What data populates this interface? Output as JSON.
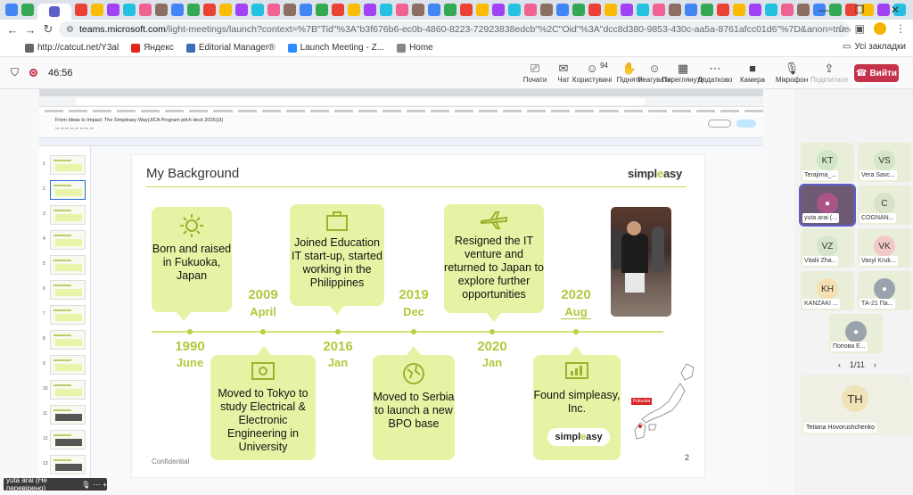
{
  "browser": {
    "url_domain": "teams.microsoft.com",
    "url_rest": "/light-meetings/launch?context=%7B\"Tid\"%3A\"b3f676b6-ec0b-4860-8223-72923838edcb\"%2C\"Oid\"%3A\"dcc8d380-9853-430c-aa5a-8761afcc01d6\"%7D&anon=true&lightExperience=true&correlationId=bbdd7927-5f89-4708-9f55-e...",
    "bookmarks": [
      {
        "label": "http://catcut.net/Y3al",
        "color": "#666666"
      },
      {
        "label": "Яндекс",
        "color": "#e52620"
      },
      {
        "label": "Editorial Manager®",
        "color": "#3b6fb6"
      },
      {
        "label": "Launch Meeting - Z...",
        "color": "#2d8cff"
      },
      {
        "label": "Home",
        "color": "#888888"
      }
    ],
    "bookmarks_right": "Усі закладки"
  },
  "meeting": {
    "timer": "46:56",
    "controls": [
      {
        "label": "Почати",
        "icon": "share-icon"
      },
      {
        "label": "Чат",
        "icon": "chat-icon"
      },
      {
        "label": "Користувачі",
        "icon": "people-icon",
        "badge": "94"
      },
      {
        "label": "Підняти",
        "icon": "raise-hand-icon"
      },
      {
        "label": "Реагувати",
        "icon": "react-icon"
      },
      {
        "label": "Переглянути",
        "icon": "view-icon"
      },
      {
        "label": "Додатково",
        "icon": "more-icon"
      },
      {
        "label": "Камера",
        "icon": "camera-icon"
      },
      {
        "label": "Мікрофон",
        "icon": "mic-icon"
      },
      {
        "label": "Поділитися",
        "icon": "share-tray-icon"
      }
    ],
    "leave_label": "Вийти",
    "self_caption": "yuta arai (Не перевірено)"
  },
  "shared_screen": {
    "doc_title": "From Ideas to Impact: The Simpleasy Way(JICA Program pitch deck 2025)(3)",
    "slide": {
      "title": "My Background",
      "logo": "simpleasy",
      "confidential": "Confidential",
      "page": "2",
      "events": [
        {
          "text": "Born and raised in Fukuoka, Japan",
          "year": "1990",
          "month": "June"
        },
        {
          "text": "Moved to Tokyo to study Electrical & Electronic Engineering in University",
          "year": "2009",
          "month": "April"
        },
        {
          "text": "Joined Education IT start-up, started working in the Philippines",
          "year": "2016",
          "month": "Jan"
        },
        {
          "text": "Moved to Serbia to launch a new BPO base",
          "year": "2019",
          "month": "Dec"
        },
        {
          "text": "Resigned the IT venture and returned to Japan to explore further opportunities",
          "year": "2020",
          "month": "Jan"
        },
        {
          "text": "Found simpleasy, Inc.",
          "year": "2020",
          "month": "Aug"
        }
      ],
      "map_label": "Fukuoka"
    }
  },
  "participants": [
    {
      "initials": "KT",
      "name": "Terajima_...",
      "color": "#cfe7c6"
    },
    {
      "initials": "VS",
      "name": "Vera Savc...",
      "color": "#d4e6c8"
    },
    {
      "initials": "",
      "name": "yuta arai (...",
      "color": "#a58"
    },
    {
      "initials": "C",
      "name": "COGNAN...",
      "color": "#d8e2c9"
    },
    {
      "initials": "VZ",
      "name": "Vitalii Zha...",
      "color": "#d5e5ce"
    },
    {
      "initials": "VK",
      "name": "Vasyl Kruk...",
      "color": "#f2c9c9"
    },
    {
      "initials": "KH",
      "name": "KANZAKI ...",
      "color": "#f4e0b3"
    },
    {
      "initials": "",
      "name": "ТА-21 Па...",
      "color": "#9aa3ab"
    },
    {
      "initials": "",
      "name": "Попова Е...",
      "color": "#9aa3ab"
    }
  ],
  "pager": "1/11",
  "big_tile": {
    "initials": "TH",
    "name": "Tetiana Hovorushchenko"
  }
}
